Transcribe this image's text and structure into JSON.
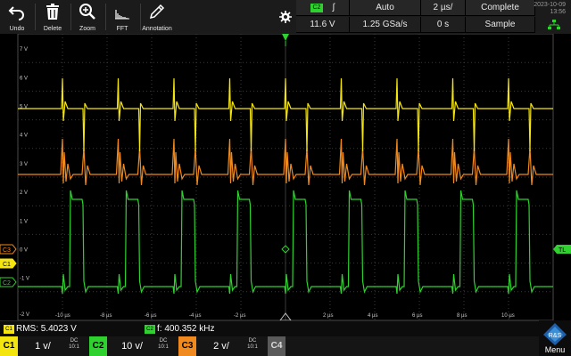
{
  "toolbar": {
    "buttons": [
      {
        "label": "Undo",
        "icon": "undo-icon"
      },
      {
        "label": "Delete",
        "icon": "trash-icon"
      },
      {
        "label": "Zoom",
        "icon": "zoom-icon"
      },
      {
        "label": "FFT",
        "icon": "fft-icon"
      },
      {
        "label": "Annotation",
        "icon": "pen-icon"
      }
    ]
  },
  "trigger": {
    "source": "C2",
    "slope_symbol": "ʃ",
    "level": "11.6 V",
    "mode": "Auto",
    "sample_rate": "1.25 GSa/s",
    "time_scale": "2 µs/",
    "position": "0 s",
    "acq_state": "Complete",
    "acq_mode": "Sample"
  },
  "date": {
    "day": "2023-10-09",
    "time": "13:56"
  },
  "grid": {
    "y_labels": [
      "7 V",
      "6 V",
      "5 V",
      "4 V",
      "3 V",
      "2 V",
      "1 V",
      "0 V",
      "-1 V",
      "-2 V"
    ],
    "x_labels": [
      "-10 µs",
      "-8 µs",
      "-6 µs",
      "-4 µs",
      "-2 µs",
      "2 µs",
      "4 µs",
      "6 µs",
      "8 µs",
      "10 µs"
    ],
    "markers": {
      "c1": "C1",
      "c2": "C2",
      "c3": "C3",
      "tl": "TL"
    }
  },
  "measurements": {
    "m1_channel": "C1",
    "m1_text": "RMS: 5.4023 V",
    "m2_channel": "C2",
    "m2_text": "f: 400.352 kHz"
  },
  "channels": [
    {
      "tag": "C1",
      "scale": "1 v/",
      "coupling": "DC",
      "probe": "10:1",
      "color": "#f5e50f"
    },
    {
      "tag": "C2",
      "scale": "10 v/",
      "coupling": "DC",
      "probe": "10:1",
      "color": "#2fd12f"
    },
    {
      "tag": "C3",
      "scale": "2 v/",
      "coupling": "DC",
      "probe": "10:1",
      "color": "#f08a1e"
    },
    {
      "tag": "C4",
      "scale": "",
      "coupling": "",
      "probe": "",
      "color": "#5a5a5a"
    }
  ],
  "menu": {
    "label": "Menu"
  },
  "colors": {
    "c1": "#f5e50f",
    "c2": "#2fd12f",
    "c3": "#f08a1e",
    "grid": "#3a3a3a",
    "background": "#000000"
  }
}
